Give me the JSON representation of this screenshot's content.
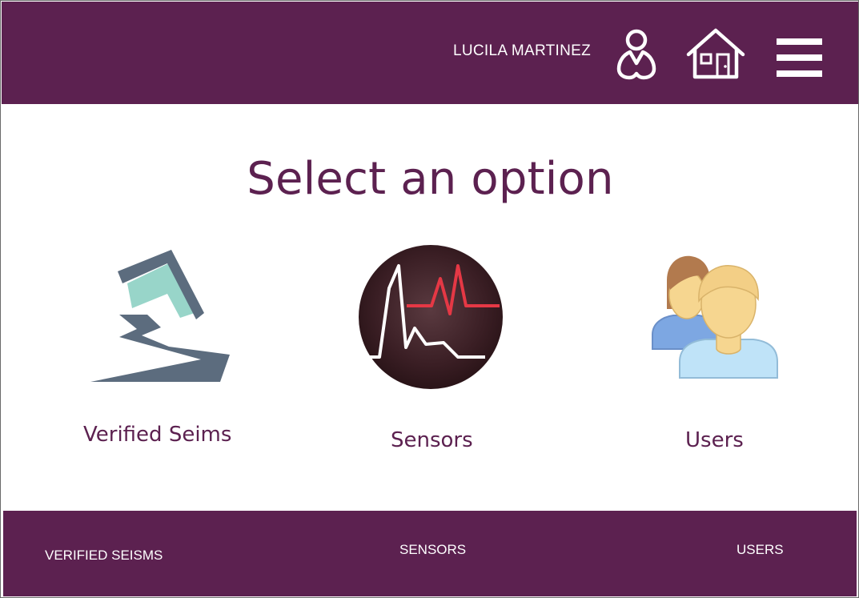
{
  "header": {
    "user_name": "LUCILA MARTINEZ",
    "icons": [
      "user-icon",
      "home-icon",
      "hamburger-menu-icon"
    ]
  },
  "main": {
    "title": "Select an option",
    "options": [
      {
        "label": "Verified Seims",
        "icon": "earthquake-icon"
      },
      {
        "label": "Sensors",
        "icon": "seismograph-icon"
      },
      {
        "label": "Users",
        "icon": "users-icon"
      }
    ]
  },
  "footer": {
    "links": [
      "VERIFIED SEISMS",
      "SENSORS",
      "USERS"
    ]
  },
  "colors": {
    "brand": "#5c2150",
    "sensor_line_red": "#e53845",
    "user_skin": "#f6d690",
    "user_shirt": "#bfe3f8"
  }
}
